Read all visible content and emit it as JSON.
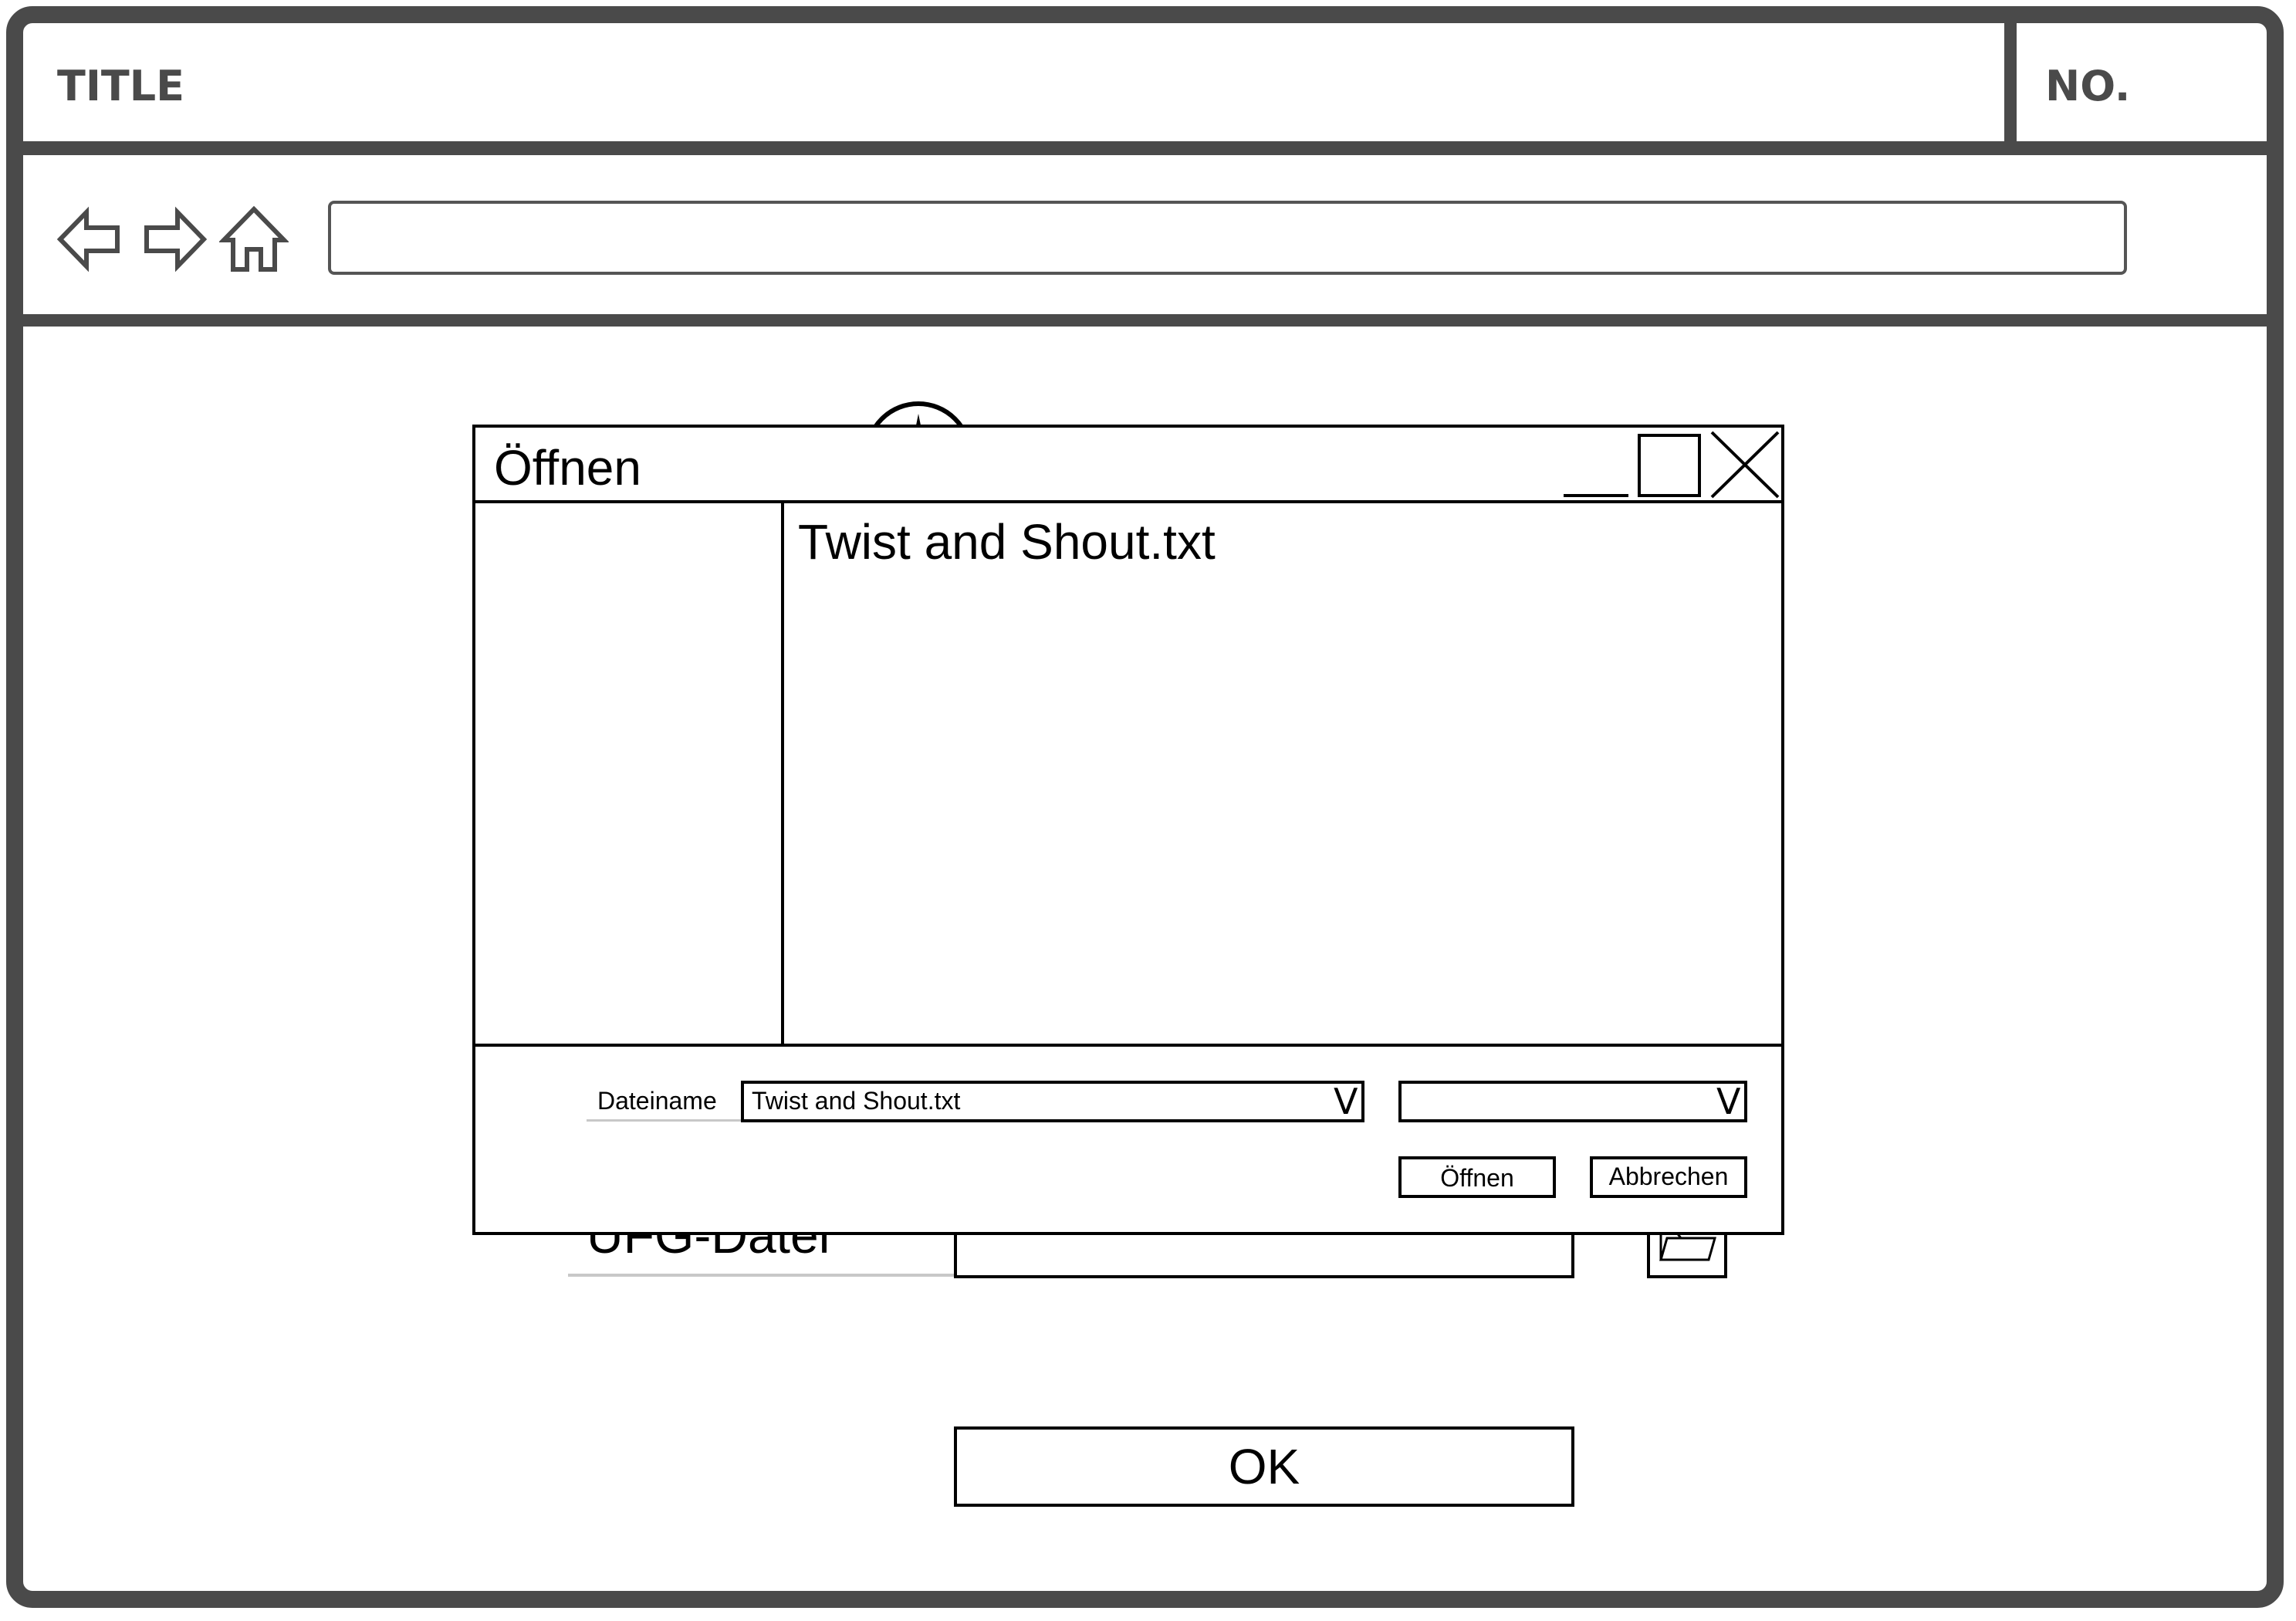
{
  "window": {
    "title": "TITLE",
    "number": "NO."
  },
  "nav": {
    "back_icon": "back-arrow-icon",
    "forward_icon": "forward-arrow-icon",
    "home_icon": "home-icon",
    "url_value": ""
  },
  "form": {
    "file_label": "UFG-Datei",
    "file_value": "",
    "browse_icon": "folder-icon",
    "ok_label": "OK"
  },
  "dialog": {
    "title": "Öffnen",
    "files": [
      "Twist and Shout.txt"
    ],
    "filename_label": "Dateiname",
    "filename_value": "Twist and Shout.txt",
    "filetype_value": "",
    "open_label": "Öffnen",
    "cancel_label": "Abbrechen"
  },
  "colors": {
    "frame": "#4a4a4a",
    "outline": "#000000",
    "underline": "#c8c8c8"
  }
}
